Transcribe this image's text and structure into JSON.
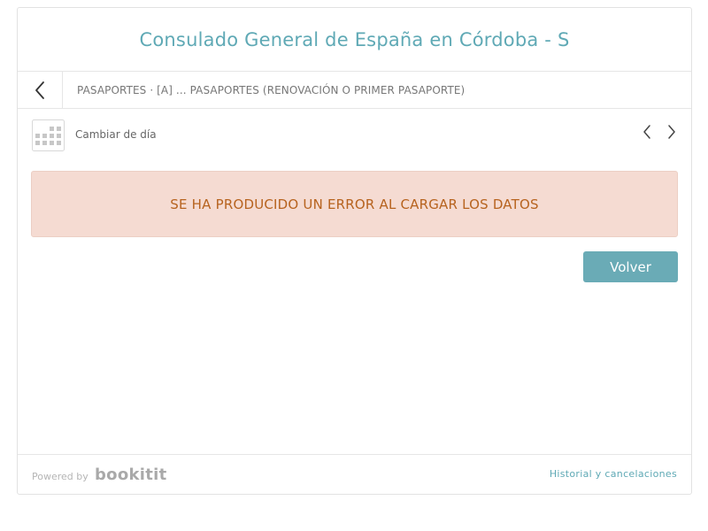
{
  "header": {
    "title": "Consulado General de España en Córdoba - S"
  },
  "navbar": {
    "back_icon": "chevron-left-icon",
    "breadcrumb": "PASAPORTES · [A] ... PASAPORTES (RENOVACIÓN O PRIMER PASAPORTE)"
  },
  "daybar": {
    "calendar_icon": "calendar-icon",
    "label": "Cambiar de día",
    "prev_icon": "chevron-left-icon",
    "next_icon": "chevron-right-icon"
  },
  "error": {
    "message": "SE HA PRODUCIDO UN ERROR AL CARGAR LOS DATOS"
  },
  "actions": {
    "back_label": "Volver"
  },
  "footer": {
    "powered_by": "Powered by",
    "brand": "bookitit",
    "history_link": "Historial y cancelaciones"
  },
  "colors": {
    "accent": "#5fa9b5",
    "button_bg": "#6aabb6",
    "error_bg": "#f5dbd2",
    "error_text": "#b7631f"
  }
}
